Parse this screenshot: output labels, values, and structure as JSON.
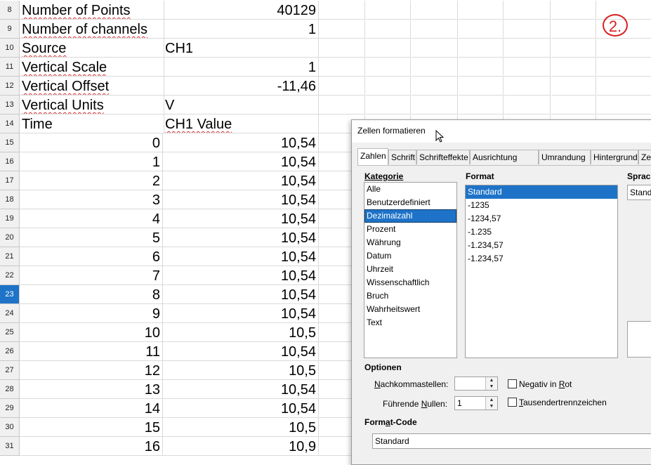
{
  "sheet": {
    "rows": [
      {
        "n": "8",
        "a": "Number of Points",
        "b": "40129",
        "a_spell": true,
        "b_num": true
      },
      {
        "n": "9",
        "a": "Number of channels",
        "b": "1",
        "a_spell": true,
        "b_num": true
      },
      {
        "n": "10",
        "a": "Source",
        "b": "CH1",
        "a_spell": true,
        "b_num": false
      },
      {
        "n": "11",
        "a": "Vertical Scale",
        "b": "1",
        "a_spell": true,
        "b_num": true
      },
      {
        "n": "12",
        "a": "Vertical Offset",
        "b": "-11,46",
        "a_spell": true,
        "b_num": true
      },
      {
        "n": "13",
        "a": "Vertical Units",
        "b": "V",
        "a_spell": true,
        "b_num": false
      },
      {
        "n": "14",
        "a": "Time",
        "b": "CH1 Value",
        "a_spell": false,
        "b_num": false,
        "b_spell": true
      },
      {
        "n": "15",
        "a": "0",
        "b": "10,54",
        "a_num": true,
        "b_num": true
      },
      {
        "n": "16",
        "a": "1",
        "b": "10,54",
        "a_num": true,
        "b_num": true
      },
      {
        "n": "17",
        "a": "2",
        "b": "10,54",
        "a_num": true,
        "b_num": true
      },
      {
        "n": "18",
        "a": "3",
        "b": "10,54",
        "a_num": true,
        "b_num": true
      },
      {
        "n": "19",
        "a": "4",
        "b": "10,54",
        "a_num": true,
        "b_num": true
      },
      {
        "n": "20",
        "a": "5",
        "b": "10,54",
        "a_num": true,
        "b_num": true
      },
      {
        "n": "21",
        "a": "6",
        "b": "10,54",
        "a_num": true,
        "b_num": true
      },
      {
        "n": "22",
        "a": "7",
        "b": "10,54",
        "a_num": true,
        "b_num": true
      },
      {
        "n": "23",
        "a": "8",
        "b": "10,54",
        "a_num": true,
        "b_num": true,
        "selected": true
      },
      {
        "n": "24",
        "a": "9",
        "b": "10,54",
        "a_num": true,
        "b_num": true
      },
      {
        "n": "25",
        "a": "10",
        "b": "10,5",
        "a_num": true,
        "b_num": true
      },
      {
        "n": "26",
        "a": "11",
        "b": "10,54",
        "a_num": true,
        "b_num": true
      },
      {
        "n": "27",
        "a": "12",
        "b": "10,5",
        "a_num": true,
        "b_num": true
      },
      {
        "n": "28",
        "a": "13",
        "b": "10,54",
        "a_num": true,
        "b_num": true
      },
      {
        "n": "29",
        "a": "14",
        "b": "10,54",
        "a_num": true,
        "b_num": true
      },
      {
        "n": "30",
        "a": "15",
        "b": "10,5",
        "a_num": true,
        "b_num": true
      },
      {
        "n": "31",
        "a": "16",
        "b": "10,9",
        "a_num": true,
        "b_num": true
      }
    ],
    "annotation": "2.",
    "selected_row_color": "#1e73c8",
    "spell_color": "#d43030"
  },
  "dialog": {
    "title": "Zellen formatieren",
    "tabs": [
      "Zahlen",
      "Schrift",
      "Schrifteffekte",
      "Ausrichtung",
      "Umrandung",
      "Hintergrund",
      "Zellschutz"
    ],
    "active_tab": "Zahlen",
    "kategorie_label": "Kategorie",
    "kategorien": [
      "Alle",
      "Benutzerdefiniert",
      "Dezimalzahl",
      "Prozent",
      "Währung",
      "Datum",
      "Uhrzeit",
      "Wissenschaftlich",
      "Bruch",
      "Wahrheitswert",
      "Text"
    ],
    "selected_kategorie": "Dezimalzahl",
    "format_label": "Format",
    "formate": [
      "Standard",
      "-1235",
      "-1234,57",
      "-1.235",
      "-1.234,57",
      "-1.234,57"
    ],
    "selected_format": "Standard",
    "sprache_label": "Sprache",
    "sprache_value": "Standard",
    "optionen_label": "Optionen",
    "nachkomma_label_pre": "N",
    "nachkomma_label_rest": "achkommastellen:",
    "nachkomma_value": "",
    "fuehrende_label_pre": "Führende ",
    "fuehrende_label_acc": "N",
    "fuehrende_label_rest": "ullen:",
    "fuehrende_value": "1",
    "negativ_label_pre": "Negativ in ",
    "negativ_label_acc": "R",
    "negativ_label_rest": "ot",
    "negativ_checked": false,
    "tausender_label_acc": "T",
    "tausender_label_rest": "ausendertrennzeichen",
    "tausender_checked": false,
    "formatcode_label_pre": "Form",
    "formatcode_label_acc": "a",
    "formatcode_label_rest": "t-Code",
    "formatcode_value": "Standard"
  }
}
